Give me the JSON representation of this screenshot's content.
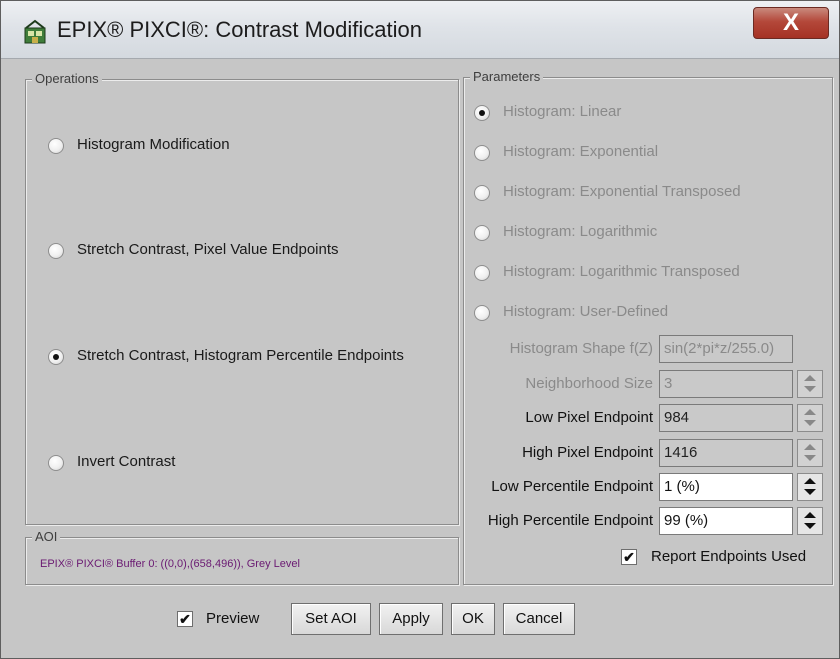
{
  "window": {
    "title": "EPIX® PIXCI®: Contrast Modification",
    "close_label": "X"
  },
  "operations": {
    "title": "Operations",
    "items": [
      {
        "label": "Histogram Modification",
        "checked": false
      },
      {
        "label": "Stretch Contrast, Pixel Value Endpoints",
        "checked": false
      },
      {
        "label": "Stretch Contrast, Histogram Percentile Endpoints",
        "checked": true
      },
      {
        "label": "Invert Contrast",
        "checked": false
      }
    ]
  },
  "aoi": {
    "title": "AOI",
    "text": "EPIX® PIXCI® Buffer 0: ((0,0),(658,496)), Grey Level"
  },
  "parameters": {
    "title": "Parameters",
    "histogram_options": [
      {
        "label": "Histogram: Linear",
        "checked": true
      },
      {
        "label": "Histogram: Exponential",
        "checked": false
      },
      {
        "label": "Histogram: Exponential Transposed",
        "checked": false
      },
      {
        "label": "Histogram: Logarithmic",
        "checked": false
      },
      {
        "label": "Histogram: Logarithmic Transposed",
        "checked": false
      },
      {
        "label": "Histogram: User-Defined",
        "checked": false
      }
    ],
    "histogram_shape": {
      "label": "Histogram Shape f(Z)",
      "value": "sin(2*pi*z/255.0)"
    },
    "neighborhood_size": {
      "label": "Neighborhood Size",
      "value": "3"
    },
    "low_pixel_endpoint": {
      "label": "Low Pixel Endpoint",
      "value": "984"
    },
    "high_pixel_endpoint": {
      "label": "High Pixel Endpoint",
      "value": "1416"
    },
    "low_percentile_endpoint": {
      "label": "Low Percentile Endpoint",
      "value": "1 (%)"
    },
    "high_percentile_endpoint": {
      "label": "High Percentile Endpoint",
      "value": "99 (%)"
    },
    "report_endpoints": {
      "label": "Report Endpoints Used",
      "checked": true
    }
  },
  "footer": {
    "preview_label": "Preview",
    "preview_checked": true,
    "set_aoi_label": "Set AOI",
    "apply_label": "Apply",
    "ok_label": "OK",
    "cancel_label": "Cancel"
  },
  "check_mark": "✔"
}
